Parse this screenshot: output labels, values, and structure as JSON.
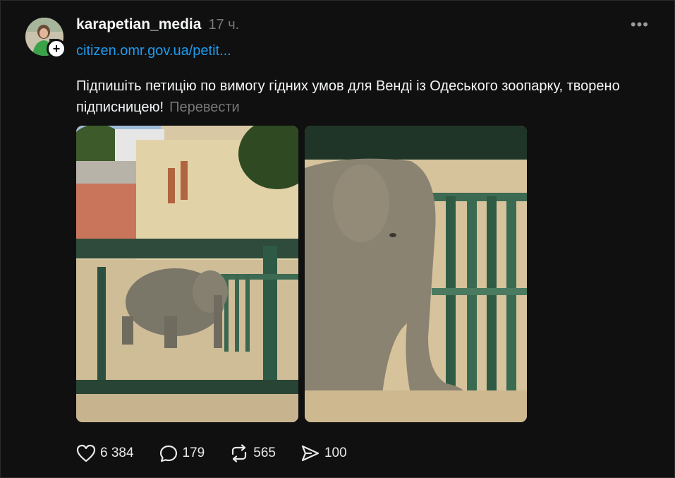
{
  "post": {
    "username": "karapetian_media",
    "timestamp": "17 ч.",
    "more_icon": "more-horizontal-icon",
    "link": "citizen.omr.gov.ua/petit...",
    "text": "Підпишіть петицію по вимогу гідних умов для Венді із Одеського зоопарку, творено підписницею!",
    "translate": "Перевести",
    "follow_icon": "plus-icon",
    "colors": {
      "background": "#101010",
      "link": "#1d9bf0",
      "muted": "#777777",
      "text": "#f3f5f7"
    }
  },
  "actions": {
    "likes": "6 384",
    "comments": "179",
    "reposts": "565",
    "shares": "100"
  }
}
